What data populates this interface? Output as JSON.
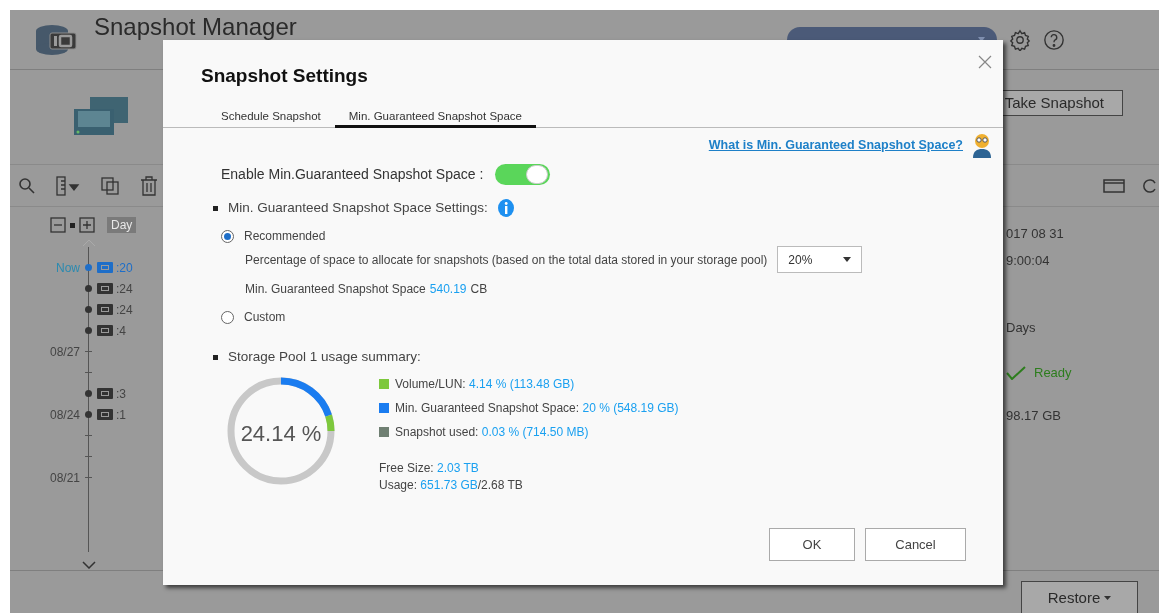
{
  "background": {
    "app_title": "Snapshot Manager",
    "take_snapshot_button": "Take Snapshot",
    "zoom_level": "Day",
    "timeline": [
      {
        "kind": "snapshot",
        "date": "Now",
        "text": ":20",
        "selected": true
      },
      {
        "kind": "snapshot",
        "text": ":24",
        "selected": false
      },
      {
        "kind": "snapshot",
        "text": ":24",
        "selected": false
      },
      {
        "kind": "snapshot",
        "text": ":4",
        "selected": false
      },
      {
        "kind": "date",
        "date": "08/27"
      },
      {
        "kind": "tick"
      },
      {
        "kind": "snapshot",
        "text": ":3",
        "selected": false
      },
      {
        "kind": "snapshot",
        "date": "08/24",
        "text": ":1",
        "selected": false
      },
      {
        "kind": "tick"
      },
      {
        "kind": "tick"
      },
      {
        "kind": "date",
        "date": "08/21"
      }
    ],
    "details": [
      {
        "kind": "text",
        "text": "017 08 31"
      },
      {
        "kind": "text",
        "text": "9:00:04"
      },
      {
        "kind": "text",
        "text": "Days"
      },
      {
        "kind": "status",
        "text": "Ready"
      },
      {
        "kind": "text",
        "text": "98.17 GB"
      }
    ],
    "restore_button": "Restore"
  },
  "dialog": {
    "title": "Snapshot Settings",
    "tabs": [
      {
        "label": "Schedule Snapshot",
        "selected": false
      },
      {
        "label": "Min. Guaranteed Snapshot Space",
        "selected": true
      }
    ],
    "help_link": "What is Min. Guaranteed Snapshot Space?",
    "enable": {
      "label": "Enable Min.Guaranteed Snapshot Space :",
      "on": true
    },
    "settings_heading": "Min. Guaranteed Snapshot Space Settings:",
    "options": [
      {
        "label": "Recommended",
        "selected": true
      },
      {
        "label": "Custom",
        "selected": false
      }
    ],
    "percentage_label": "Percentage of space to allocate for snapshots (based on the total data stored in your storage pool)",
    "percentage_value": "20%",
    "space_label": "Min. Guaranteed Snapshot Space",
    "space_value": "540.19",
    "space_unit": "CB",
    "summary_heading": "Storage Pool 1 usage summary:",
    "donut_center": "24.14 %",
    "legend": [
      {
        "label": "Volume/LUN:",
        "value": "4.14 % (113.48 GB)",
        "color": "#7dc83c"
      },
      {
        "label": "Min. Guaranteed Snapshot Space:",
        "value": "20 % (548.19 GB)",
        "color": "#1a7cf0"
      },
      {
        "label": "Snapshot used:",
        "value": "0.03 % (714.50 MB)",
        "color": "#6f7f72"
      }
    ],
    "free_size": {
      "label": "Free Size:",
      "value": "2.03 TB"
    },
    "usage": {
      "label": "Usage:",
      "value": "651.73 GB",
      "total": "/2.68 TB"
    },
    "buttons": [
      "OK",
      "Cancel"
    ]
  }
}
